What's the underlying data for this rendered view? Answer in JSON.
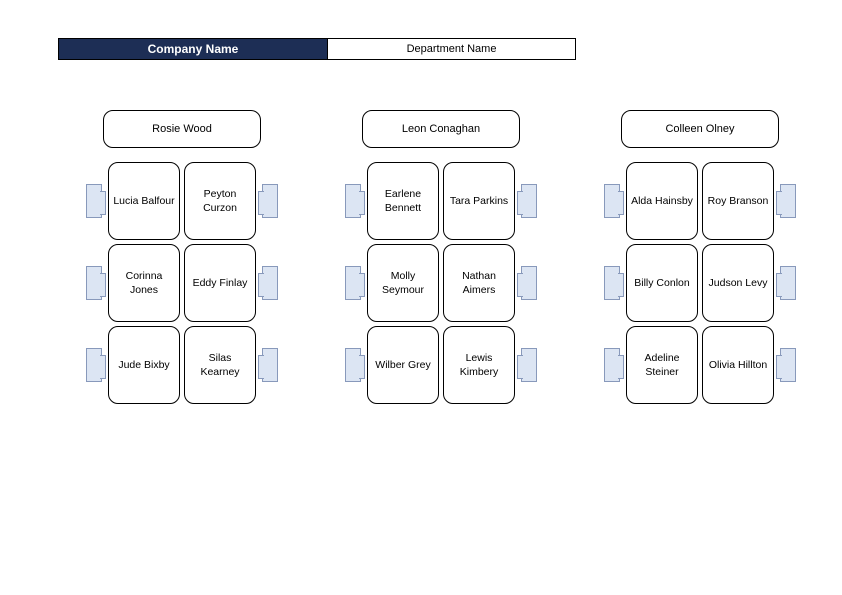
{
  "header": {
    "company": "Company Name",
    "department": "Department Name"
  },
  "tables": [
    {
      "head": "Rosie Wood",
      "rows": [
        {
          "left": "Lucia Balfour",
          "right": "Peyton Curzon"
        },
        {
          "left": "Corinna Jones",
          "right": "Eddy Finlay"
        },
        {
          "left": "Jude Bixby",
          "right": "Silas Kearney"
        }
      ]
    },
    {
      "head": "Leon Conaghan",
      "rows": [
        {
          "left": "Earlene Bennett",
          "right": "Tara Parkins"
        },
        {
          "left": "Molly Seymour",
          "right": "Nathan Aimers"
        },
        {
          "left": "Wilber Grey",
          "right": "Lewis Kimbery"
        }
      ]
    },
    {
      "head": "Colleen Olney",
      "rows": [
        {
          "left": "Alda Hainsby",
          "right": "Roy Branson"
        },
        {
          "left": "Billy Conlon",
          "right": "Judson Levy"
        },
        {
          "left": "Adeline Steiner",
          "right": "Olivia Hillton"
        }
      ]
    }
  ]
}
